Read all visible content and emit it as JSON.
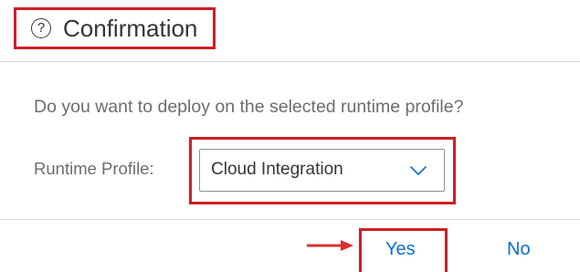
{
  "dialog": {
    "title": "Confirmation",
    "help_icon_glyph": "?",
    "question": "Do you want to deploy on the selected runtime profile?",
    "runtime_profile": {
      "label": "Runtime Profile:",
      "selected_value": "Cloud Integration"
    },
    "buttons": {
      "yes_label": "Yes",
      "no_label": "No"
    }
  },
  "icons": {
    "help": "question-circle-icon",
    "dropdown": "chevron-down-icon",
    "annotation": "red-arrow-icon"
  },
  "colors": {
    "highlight": "#cc1f24",
    "link_button": "#0a6ed1",
    "title_text": "#32363a",
    "body_text": "#6a6d70",
    "divider": "#d9d9d9"
  }
}
